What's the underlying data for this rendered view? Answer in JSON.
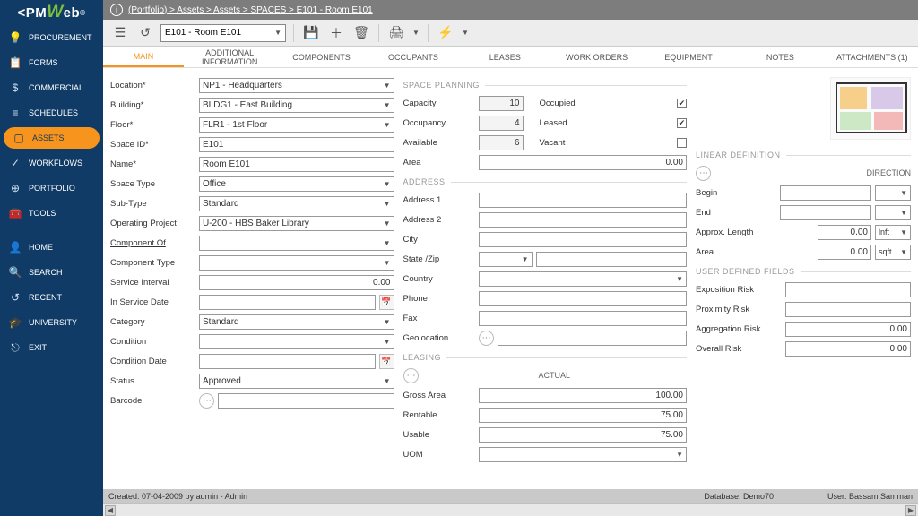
{
  "logo": {
    "pm": "PM",
    "w": "W",
    "eb": "eb"
  },
  "sidebar": {
    "items": [
      {
        "icon": "💡",
        "label": "PROCUREMENT"
      },
      {
        "icon": "📋",
        "label": "FORMS"
      },
      {
        "icon": "$",
        "label": "COMMERCIAL"
      },
      {
        "icon": "≡",
        "label": "SCHEDULES"
      },
      {
        "icon": "▢",
        "label": "ASSETS",
        "active": true
      },
      {
        "icon": "✓",
        "label": "WORKFLOWS"
      },
      {
        "icon": "⊕",
        "label": "PORTFOLIO"
      },
      {
        "icon": "🧰",
        "label": "TOOLS"
      }
    ],
    "bottom": [
      {
        "icon": "👤",
        "label": "HOME"
      },
      {
        "icon": "🔍",
        "label": "SEARCH"
      },
      {
        "icon": "↺",
        "label": "RECENT"
      },
      {
        "icon": "🎓",
        "label": "UNIVERSITY"
      },
      {
        "icon": "⎋",
        "label": "EXIT"
      }
    ]
  },
  "breadcrumb": "(Portfolio) > Assets > Assets > SPACES > E101 - Room E101",
  "record_select": "E101 - Room E101",
  "tabs": [
    "MAIN",
    "ADDITIONAL INFORMATION",
    "COMPONENTS",
    "OCCUPANTS",
    "LEASES",
    "WORK ORDERS",
    "EQUIPMENT",
    "NOTES",
    "ATTACHMENTS (1)"
  ],
  "col1": {
    "location": {
      "label": "Location*",
      "value": "NP1 - Headquarters"
    },
    "building": {
      "label": "Building*",
      "value": "BLDG1 - East Building"
    },
    "floor": {
      "label": "Floor*",
      "value": "FLR1 - 1st Floor"
    },
    "spaceid": {
      "label": "Space ID*",
      "value": "E101"
    },
    "name": {
      "label": "Name*",
      "value": "Room E101"
    },
    "spacetype": {
      "label": "Space Type",
      "value": "Office"
    },
    "subtype": {
      "label": "Sub-Type",
      "value": "Standard"
    },
    "opproj": {
      "label": "Operating Project",
      "value": "U-200 - HBS Baker Library"
    },
    "compof": {
      "label": "Component Of"
    },
    "comptype": {
      "label": "Component Type",
      "value": ""
    },
    "svcint": {
      "label": "Service Interval",
      "value": "0.00"
    },
    "insvc": {
      "label": "In Service Date",
      "value": ""
    },
    "category": {
      "label": "Category",
      "value": "Standard"
    },
    "condition": {
      "label": "Condition",
      "value": ""
    },
    "conddate": {
      "label": "Condition Date",
      "value": ""
    },
    "status": {
      "label": "Status",
      "value": "Approved"
    },
    "barcode": {
      "label": "Barcode",
      "value": ""
    }
  },
  "col2": {
    "space_planning": "SPACE PLANNING",
    "capacity": {
      "label": "Capacity",
      "value": "10",
      "check": "Occupied",
      "checked": true
    },
    "occupancy": {
      "label": "Occupancy",
      "value": "4",
      "check": "Leased",
      "checked": true
    },
    "available": {
      "label": "Available",
      "value": "6",
      "check": "Vacant",
      "checked": false
    },
    "area": {
      "label": "Area",
      "value": "0.00"
    },
    "address_hdr": "ADDRESS",
    "address1": {
      "label": "Address 1"
    },
    "address2": {
      "label": "Address 2"
    },
    "city": {
      "label": "City"
    },
    "statezip": {
      "label": "State /Zip"
    },
    "country": {
      "label": "Country"
    },
    "phone": {
      "label": "Phone"
    },
    "fax": {
      "label": "Fax"
    },
    "geo": {
      "label": "Geolocation"
    },
    "leasing_hdr": "LEASING",
    "actual": "ACTUAL",
    "gross": {
      "label": "Gross Area",
      "value": "100.00"
    },
    "rentable": {
      "label": "Rentable",
      "value": "75.00"
    },
    "usable": {
      "label": "Usable",
      "value": "75.00"
    },
    "uom": {
      "label": "UOM"
    }
  },
  "col3": {
    "linear_hdr": "LINEAR DEFINITION",
    "direction": "DIRECTION",
    "begin": {
      "label": "Begin"
    },
    "end": {
      "label": "End"
    },
    "approx": {
      "label": "Approx. Length",
      "value": "0.00",
      "unit": "lnft"
    },
    "area": {
      "label": "Area",
      "value": "0.00",
      "unit": "sqft"
    },
    "udf_hdr": "USER DEFINED FIELDS",
    "udf1": {
      "label": "Exposition Risk",
      "value": ""
    },
    "udf2": {
      "label": "Proximity Risk",
      "value": ""
    },
    "udf3": {
      "label": "Aggregation Risk",
      "value": "0.00"
    },
    "udf4": {
      "label": "Overall Risk",
      "value": "0.00"
    }
  },
  "footer": {
    "created": "Created:  07-04-2009 by admin - Admin",
    "db": "Database:   Demo70",
    "user": "User:   Bassam Samman"
  }
}
